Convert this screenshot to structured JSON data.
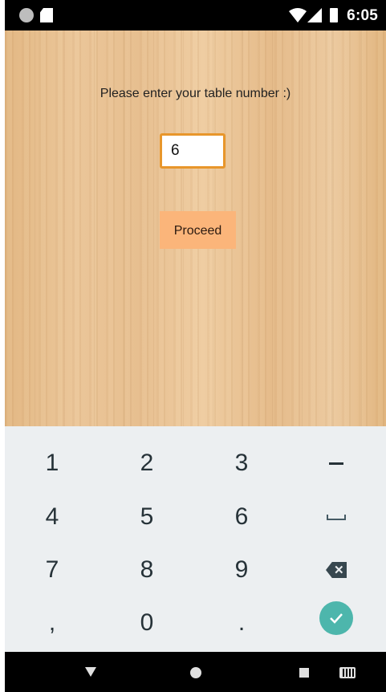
{
  "status_bar": {
    "time": "6:05",
    "icons": [
      "notification-dot-icon",
      "sd-card-icon",
      "wifi-icon",
      "signal-icon",
      "battery-icon"
    ]
  },
  "main": {
    "prompt": "Please enter your table number :)",
    "table_input": {
      "value": "6",
      "placeholder": ""
    },
    "proceed_label": "Proceed"
  },
  "keyboard": {
    "rows": [
      [
        "1",
        "2",
        "3",
        "-"
      ],
      [
        "4",
        "5",
        "6",
        "space"
      ],
      [
        "7",
        "8",
        "9",
        "backspace"
      ],
      [
        ",",
        "0",
        ".",
        "done"
      ]
    ],
    "labels": {
      "k1": "1",
      "k2": "2",
      "k3": "3",
      "k4": "4",
      "k5": "5",
      "k6": "6",
      "k7": "7",
      "k8": "8",
      "k9": "9",
      "comma": ",",
      "k0": "0",
      "period": "."
    },
    "accent_color": "#4db6ac"
  },
  "nav_bar": {
    "icons": [
      "back-icon",
      "home-icon",
      "recents-icon",
      "keyboard-switch-icon"
    ]
  },
  "colors": {
    "field_border": "#e8962b",
    "proceed_bg": "#fbb57a",
    "keyboard_bg": "#eceff1"
  }
}
